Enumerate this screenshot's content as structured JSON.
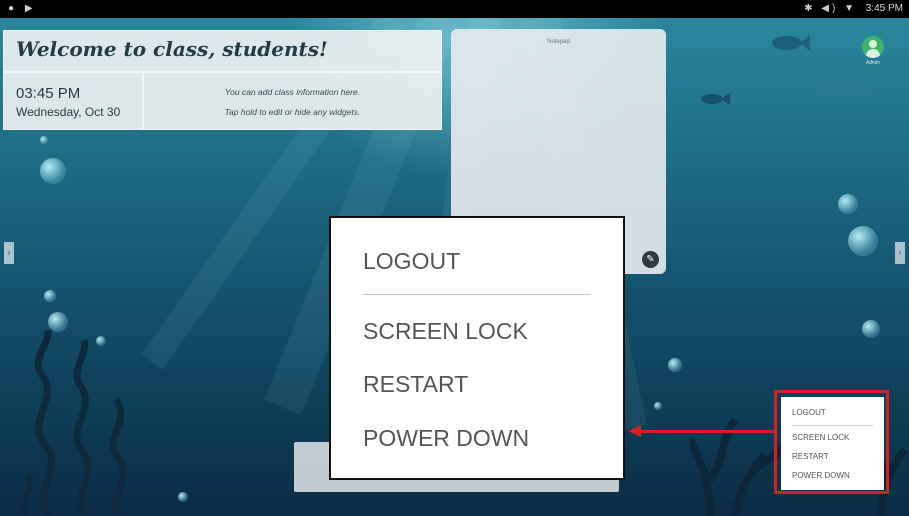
{
  "status_bar": {
    "left_icons": "● ▶",
    "right_icons": "✱ ◀) ▼",
    "time": "3:45 PM"
  },
  "welcome": {
    "title": "Welcome to class, students!"
  },
  "clock": {
    "time": "03:45 PM",
    "date": "Wednesday, Oct 30"
  },
  "info": {
    "line1": "You can add class information here.",
    "line2": "Tap hold to edit or hide any widgets."
  },
  "notepad": {
    "title": "Notepad",
    "edit_icon": "pencil-icon"
  },
  "user": {
    "label": "Admin",
    "icon": "user-avatar-icon",
    "color": "#3fb36a"
  },
  "side_handles": {
    "left": "›",
    "right": "‹"
  },
  "power_menu": {
    "items": [
      "LOGOUT",
      "SCREEN LOCK",
      "RESTART",
      "POWER DOWN"
    ]
  },
  "annotation": {
    "color": "#d61f1f",
    "mini_items": [
      "LOGOUT",
      "SCREEN LOCK",
      "RESTART",
      "POWER DOWN"
    ]
  }
}
